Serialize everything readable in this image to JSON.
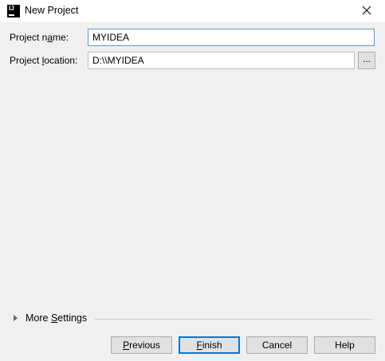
{
  "window": {
    "title": "New Project",
    "app_icon_text": "IJ"
  },
  "form": {
    "name_label_pre": "Project n",
    "name_label_mn": "a",
    "name_label_post": "me:",
    "name_value": "MYIDEA",
    "location_label_pre": "Project ",
    "location_label_mn": "l",
    "location_label_post": "ocation:",
    "location_value": "D:\\\\MYIDEA",
    "browse_label": "..."
  },
  "more_settings": {
    "pre": "More ",
    "mn": "S",
    "post": "ettings"
  },
  "buttons": {
    "previous_mn": "P",
    "previous_rest": "revious",
    "finish_mn": "F",
    "finish_rest": "inish",
    "cancel": "Cancel",
    "help": "Help"
  }
}
